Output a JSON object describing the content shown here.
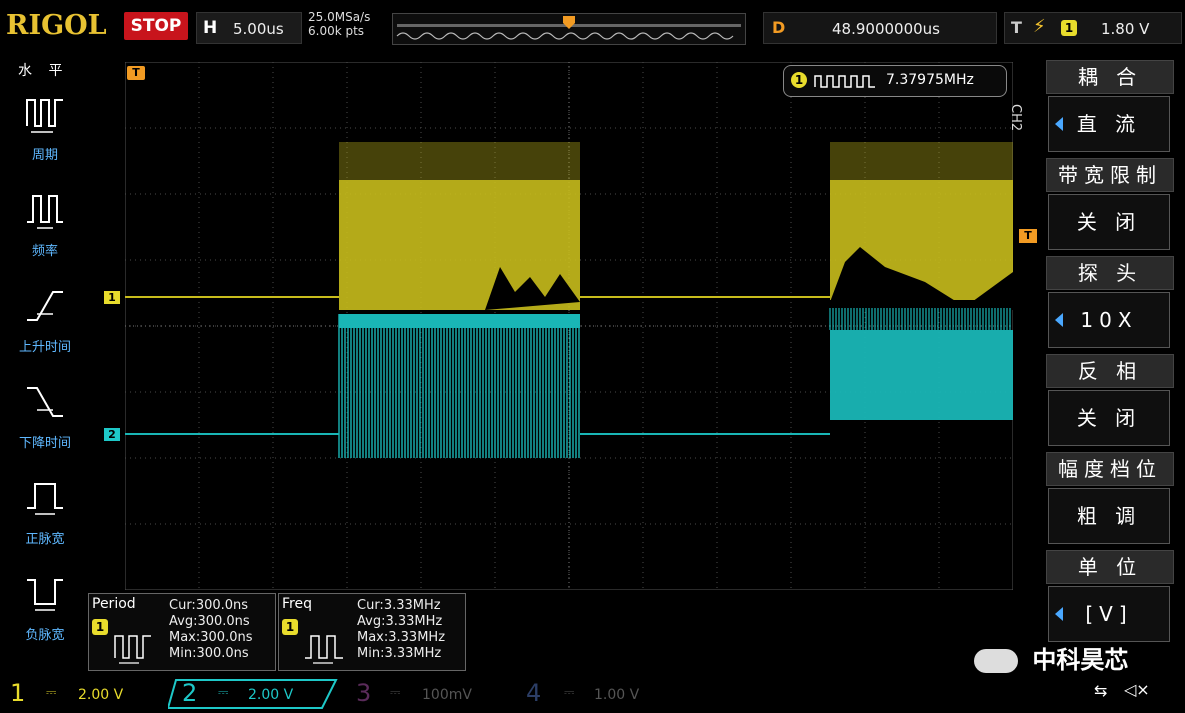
{
  "brand": "RIGOL",
  "status": "STOP",
  "horizontal": {
    "label": "H",
    "timebase": "5.00us"
  },
  "sample": {
    "rate": "25.0MSa/s",
    "points": "6.00k pts"
  },
  "delay": {
    "label": "D",
    "value": "48.9000000us"
  },
  "trigger": {
    "label": "T",
    "edge_icon": "rising-edge-icon",
    "channel": "1",
    "level": "1.80 V"
  },
  "left_menu": {
    "title": "水 平",
    "items": [
      {
        "label": "周期",
        "icon": "period-icon"
      },
      {
        "label": "频率",
        "icon": "frequency-icon"
      },
      {
        "label": "上升时间",
        "icon": "rise-time-icon"
      },
      {
        "label": "下降时间",
        "icon": "fall-time-icon"
      },
      {
        "label": "正脉宽",
        "icon": "positive-width-icon"
      },
      {
        "label": "负脉宽",
        "icon": "negative-width-icon"
      }
    ]
  },
  "counter": {
    "channel": "1",
    "value": "7.37975MHz"
  },
  "markers": {
    "trigger_top": "T",
    "ch1": "1",
    "ch2": "2",
    "trigger_right": "T"
  },
  "right_menu": {
    "channel_label": "CH2",
    "items": [
      {
        "head": "耦 合",
        "value": "直 流"
      },
      {
        "head": "带宽限制",
        "value": "关 闭"
      },
      {
        "head": "探 头",
        "value": "10X"
      },
      {
        "head": "反 相",
        "value": "关 闭"
      },
      {
        "head": "幅度档位",
        "value": "粗 调"
      },
      {
        "head": "单 位",
        "value": "[V]"
      }
    ]
  },
  "measurements": [
    {
      "title": "Period",
      "channel": "1",
      "cur": "Cur:300.0ns",
      "avg": "Avg:300.0ns",
      "max": "Max:300.0ns",
      "min": "Min:300.0ns"
    },
    {
      "title": "Freq",
      "channel": "1",
      "cur": "Cur:3.33MHz",
      "avg": "Avg:3.33MHz",
      "max": "Max:3.33MHz",
      "min": "Min:3.33MHz"
    }
  ],
  "channels": [
    {
      "num": "1",
      "coupling_icon": "dc-coupling-icon",
      "scale": "2.00 V",
      "color": "#e8dc2c",
      "active": true
    },
    {
      "num": "2",
      "coupling_icon": "dc-coupling-icon",
      "scale": "2.00 V",
      "color": "#1ec8c8",
      "active": true
    },
    {
      "num": "3",
      "coupling_icon": "dc-coupling-icon",
      "scale": "100mV",
      "color": "#b040b0",
      "active": false
    },
    {
      "num": "4",
      "coupling_icon": "dc-coupling-icon",
      "scale": "1.00 V",
      "color": "#3a6ad0",
      "active": false
    }
  ],
  "watermark": "中科昊芯",
  "colors": {
    "ch1": "#c8bc1c",
    "ch2": "#19b6b6",
    "trigger": "#f29b23",
    "grid": "#4a4a4a"
  }
}
